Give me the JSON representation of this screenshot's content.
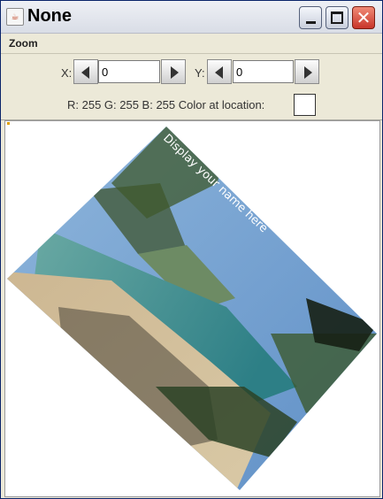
{
  "window": {
    "title": "None"
  },
  "menu": {
    "items": [
      "Zoom"
    ]
  },
  "controls": {
    "x_label": "X:",
    "x_value": "0",
    "y_label": "Y:",
    "y_value": "0",
    "color_info": "R: 255 G: 255 B: 255 Color at location:",
    "swatch_color": "#ffffff"
  },
  "image": {
    "overlay_text": "Display your name here",
    "description_icon": "rotated-beach-photo"
  }
}
